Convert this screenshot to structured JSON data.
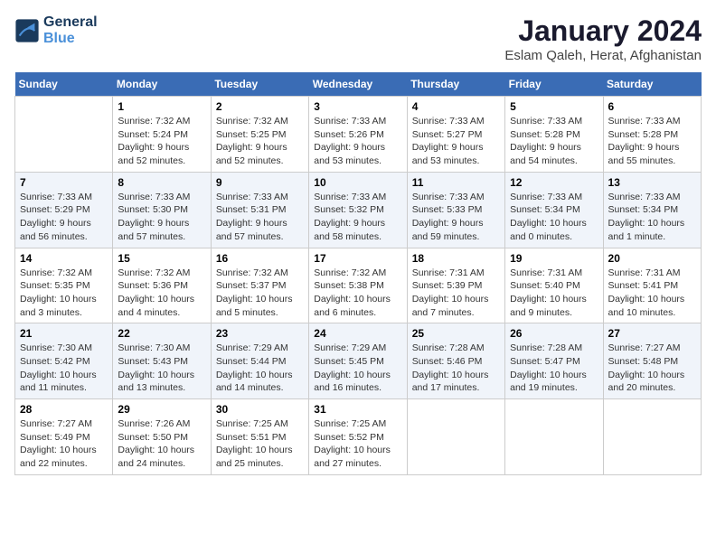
{
  "logo": {
    "line1": "General",
    "line2": "Blue"
  },
  "title": "January 2024",
  "subtitle": "Eslam Qaleh, Herat, Afghanistan",
  "days_of_week": [
    "Sunday",
    "Monday",
    "Tuesday",
    "Wednesday",
    "Thursday",
    "Friday",
    "Saturday"
  ],
  "weeks": [
    [
      {
        "num": "",
        "info": ""
      },
      {
        "num": "1",
        "info": "Sunrise: 7:32 AM\nSunset: 5:24 PM\nDaylight: 9 hours\nand 52 minutes."
      },
      {
        "num": "2",
        "info": "Sunrise: 7:32 AM\nSunset: 5:25 PM\nDaylight: 9 hours\nand 52 minutes."
      },
      {
        "num": "3",
        "info": "Sunrise: 7:33 AM\nSunset: 5:26 PM\nDaylight: 9 hours\nand 53 minutes."
      },
      {
        "num": "4",
        "info": "Sunrise: 7:33 AM\nSunset: 5:27 PM\nDaylight: 9 hours\nand 53 minutes."
      },
      {
        "num": "5",
        "info": "Sunrise: 7:33 AM\nSunset: 5:28 PM\nDaylight: 9 hours\nand 54 minutes."
      },
      {
        "num": "6",
        "info": "Sunrise: 7:33 AM\nSunset: 5:28 PM\nDaylight: 9 hours\nand 55 minutes."
      }
    ],
    [
      {
        "num": "7",
        "info": "Sunrise: 7:33 AM\nSunset: 5:29 PM\nDaylight: 9 hours\nand 56 minutes."
      },
      {
        "num": "8",
        "info": "Sunrise: 7:33 AM\nSunset: 5:30 PM\nDaylight: 9 hours\nand 57 minutes."
      },
      {
        "num": "9",
        "info": "Sunrise: 7:33 AM\nSunset: 5:31 PM\nDaylight: 9 hours\nand 57 minutes."
      },
      {
        "num": "10",
        "info": "Sunrise: 7:33 AM\nSunset: 5:32 PM\nDaylight: 9 hours\nand 58 minutes."
      },
      {
        "num": "11",
        "info": "Sunrise: 7:33 AM\nSunset: 5:33 PM\nDaylight: 9 hours\nand 59 minutes."
      },
      {
        "num": "12",
        "info": "Sunrise: 7:33 AM\nSunset: 5:34 PM\nDaylight: 10 hours\nand 0 minutes."
      },
      {
        "num": "13",
        "info": "Sunrise: 7:33 AM\nSunset: 5:34 PM\nDaylight: 10 hours\nand 1 minute."
      }
    ],
    [
      {
        "num": "14",
        "info": "Sunrise: 7:32 AM\nSunset: 5:35 PM\nDaylight: 10 hours\nand 3 minutes."
      },
      {
        "num": "15",
        "info": "Sunrise: 7:32 AM\nSunset: 5:36 PM\nDaylight: 10 hours\nand 4 minutes."
      },
      {
        "num": "16",
        "info": "Sunrise: 7:32 AM\nSunset: 5:37 PM\nDaylight: 10 hours\nand 5 minutes."
      },
      {
        "num": "17",
        "info": "Sunrise: 7:32 AM\nSunset: 5:38 PM\nDaylight: 10 hours\nand 6 minutes."
      },
      {
        "num": "18",
        "info": "Sunrise: 7:31 AM\nSunset: 5:39 PM\nDaylight: 10 hours\nand 7 minutes."
      },
      {
        "num": "19",
        "info": "Sunrise: 7:31 AM\nSunset: 5:40 PM\nDaylight: 10 hours\nand 9 minutes."
      },
      {
        "num": "20",
        "info": "Sunrise: 7:31 AM\nSunset: 5:41 PM\nDaylight: 10 hours\nand 10 minutes."
      }
    ],
    [
      {
        "num": "21",
        "info": "Sunrise: 7:30 AM\nSunset: 5:42 PM\nDaylight: 10 hours\nand 11 minutes."
      },
      {
        "num": "22",
        "info": "Sunrise: 7:30 AM\nSunset: 5:43 PM\nDaylight: 10 hours\nand 13 minutes."
      },
      {
        "num": "23",
        "info": "Sunrise: 7:29 AM\nSunset: 5:44 PM\nDaylight: 10 hours\nand 14 minutes."
      },
      {
        "num": "24",
        "info": "Sunrise: 7:29 AM\nSunset: 5:45 PM\nDaylight: 10 hours\nand 16 minutes."
      },
      {
        "num": "25",
        "info": "Sunrise: 7:28 AM\nSunset: 5:46 PM\nDaylight: 10 hours\nand 17 minutes."
      },
      {
        "num": "26",
        "info": "Sunrise: 7:28 AM\nSunset: 5:47 PM\nDaylight: 10 hours\nand 19 minutes."
      },
      {
        "num": "27",
        "info": "Sunrise: 7:27 AM\nSunset: 5:48 PM\nDaylight: 10 hours\nand 20 minutes."
      }
    ],
    [
      {
        "num": "28",
        "info": "Sunrise: 7:27 AM\nSunset: 5:49 PM\nDaylight: 10 hours\nand 22 minutes."
      },
      {
        "num": "29",
        "info": "Sunrise: 7:26 AM\nSunset: 5:50 PM\nDaylight: 10 hours\nand 24 minutes."
      },
      {
        "num": "30",
        "info": "Sunrise: 7:25 AM\nSunset: 5:51 PM\nDaylight: 10 hours\nand 25 minutes."
      },
      {
        "num": "31",
        "info": "Sunrise: 7:25 AM\nSunset: 5:52 PM\nDaylight: 10 hours\nand 27 minutes."
      },
      {
        "num": "",
        "info": ""
      },
      {
        "num": "",
        "info": ""
      },
      {
        "num": "",
        "info": ""
      }
    ]
  ]
}
